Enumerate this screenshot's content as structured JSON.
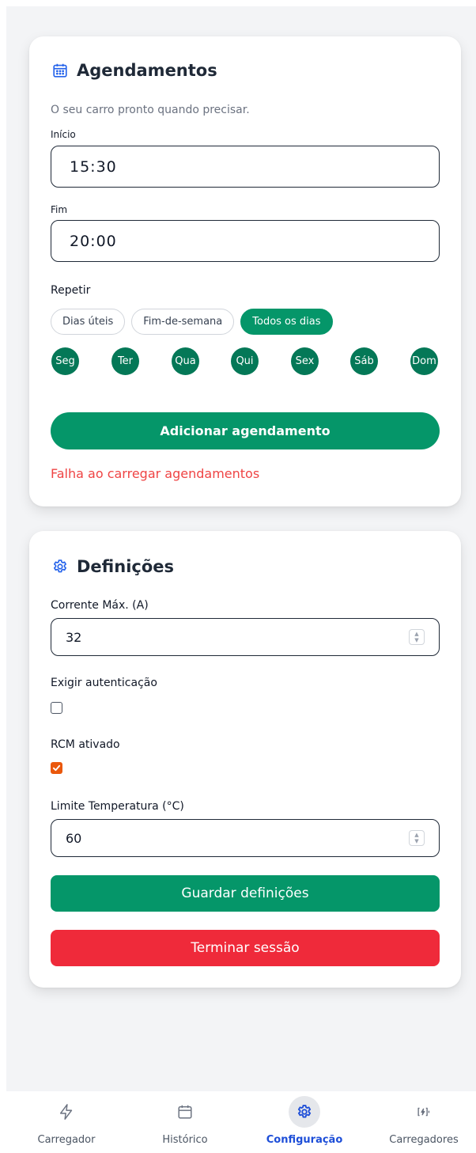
{
  "schedules": {
    "title": "Agendamentos",
    "subtitle": "O seu carro pronto quando precisar.",
    "start_label": "Início",
    "start_value": "15:30",
    "end_label": "Fim",
    "end_value": "20:00",
    "repeat_label": "Repetir",
    "repeat_options": [
      {
        "label": "Dias úteis",
        "active": false
      },
      {
        "label": "Fim-de-semana",
        "active": false
      },
      {
        "label": "Todos os dias",
        "active": true
      }
    ],
    "days": [
      "Seg",
      "Ter",
      "Qua",
      "Qui",
      "Sex",
      "Sáb",
      "Dom"
    ],
    "add_button": "Adicionar agendamento",
    "error": "Falha ao carregar agendamentos"
  },
  "settings": {
    "title": "Definições",
    "max_current_label": "Corrente Máx. (A)",
    "max_current_value": "32",
    "require_auth_label": "Exigir autenticação",
    "require_auth_checked": false,
    "rcm_label": "RCM ativado",
    "rcm_checked": true,
    "temp_limit_label": "Limite Temperatura (°C)",
    "temp_limit_value": "60",
    "save_button": "Guardar definições",
    "logout_button": "Terminar sessão"
  },
  "nav": {
    "items": [
      {
        "label": "Carregador",
        "icon": "lightning-icon",
        "active": false
      },
      {
        "label": "Histórico",
        "icon": "calendar-icon",
        "active": false
      },
      {
        "label": "Configuração",
        "icon": "gear-icon",
        "active": true
      },
      {
        "label": "Carregadores",
        "icon": "charger-icon",
        "active": false
      }
    ]
  },
  "colors": {
    "primary": "#059669",
    "day_bg": "#047857",
    "danger": "#ef2a3a",
    "error_text": "#ef4444",
    "checkbox_checked": "#ea580c",
    "nav_active": "#1d4ed8",
    "title_icon": "#2563eb"
  }
}
